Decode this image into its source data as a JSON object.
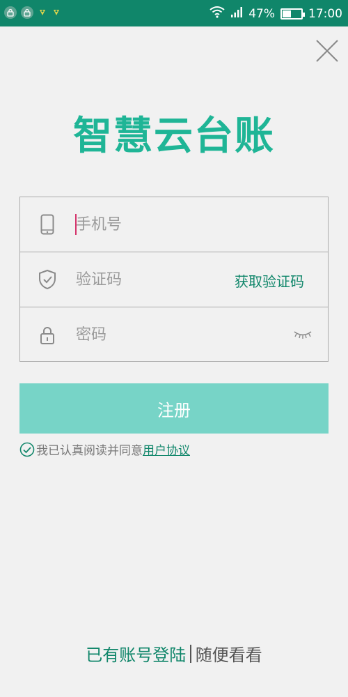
{
  "status_bar": {
    "battery_percent": "47%",
    "battery_level": 0.47,
    "time": "17:00"
  },
  "app_title": "智慧云台账",
  "form": {
    "phone_placeholder": "手机号",
    "code_placeholder": "验证码",
    "get_code_label": "获取验证码",
    "password_placeholder": "密码"
  },
  "register_label": "注册",
  "agreement": {
    "text": "我已认真阅读并同意",
    "link": "用户协议"
  },
  "bottom": {
    "login_label": "已有账号登陆",
    "browse_label": "随便看看"
  },
  "colors": {
    "status_bar": "#10866a",
    "title": "#1fb596",
    "button": "#77d4c7",
    "accent": "#10866a"
  },
  "icons": [
    "lock-notification-icon",
    "phone-icon",
    "shield-check-icon",
    "padlock-icon",
    "eye-closed-icon",
    "close-icon",
    "check-circle-icon",
    "wifi-icon",
    "signal-icon",
    "battery-icon"
  ]
}
